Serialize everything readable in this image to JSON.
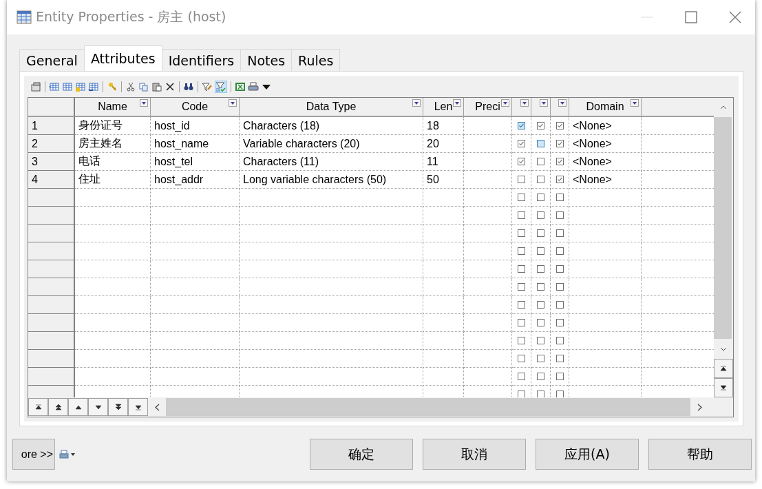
{
  "window": {
    "title": "Entity Properties - 房主 (host)"
  },
  "tabs": [
    {
      "label": "General",
      "selected": false
    },
    {
      "label": "Attributes",
      "selected": true
    },
    {
      "label": "Identifiers",
      "selected": false
    },
    {
      "label": "Notes",
      "selected": false
    },
    {
      "label": "Rules",
      "selected": false
    }
  ],
  "toolbar": {
    "filter_toggle_on": true
  },
  "table": {
    "columns": [
      {
        "kind": "text",
        "label": "Name"
      },
      {
        "kind": "text",
        "label": "Code"
      },
      {
        "kind": "text",
        "label": "Data Type"
      },
      {
        "kind": "text",
        "label": "Len"
      },
      {
        "kind": "text",
        "label": "Preci"
      },
      {
        "kind": "check"
      },
      {
        "kind": "check"
      },
      {
        "kind": "check"
      },
      {
        "kind": "text",
        "label": "Domain"
      }
    ],
    "rows": [
      {
        "number": "1",
        "name": "身份证号",
        "code": "host_id",
        "data_type": "Characters (18)",
        "length": "18",
        "domain": "<None>",
        "checks": [
          {
            "checked": true,
            "highlighted": true
          },
          {
            "checked": true,
            "highlighted": false
          },
          {
            "checked": true,
            "highlighted": false
          }
        ]
      },
      {
        "number": "2",
        "name": "房主姓名",
        "code": "host_name",
        "data_type": "Variable characters (20)",
        "length": "20",
        "domain": "<None>",
        "checks": [
          {
            "checked": true,
            "highlighted": false
          },
          {
            "checked": false,
            "highlighted": true
          },
          {
            "checked": true,
            "highlighted": false
          }
        ]
      },
      {
        "number": "3",
        "name": "电话",
        "code": "host_tel",
        "data_type": "Characters (11)",
        "length": "11",
        "domain": "<None>",
        "checks": [
          {
            "checked": true,
            "highlighted": false
          },
          {
            "checked": false,
            "highlighted": false
          },
          {
            "checked": true,
            "highlighted": false
          }
        ]
      },
      {
        "number": "4",
        "name": "住址",
        "code": "host_addr",
        "data_type": "Long variable characters (50)",
        "length": "50",
        "domain": "<None>",
        "checks": [
          {
            "checked": false,
            "highlighted": false
          },
          {
            "checked": false,
            "highlighted": false
          },
          {
            "checked": true,
            "highlighted": false
          }
        ]
      },
      {
        "checks": [
          {
            "checked": false,
            "highlighted": false
          },
          {
            "checked": false,
            "highlighted": false
          },
          {
            "checked": false,
            "highlighted": false
          }
        ]
      },
      {
        "checks": [
          {
            "checked": false,
            "highlighted": false
          },
          {
            "checked": false,
            "highlighted": false
          },
          {
            "checked": false,
            "highlighted": false
          }
        ]
      },
      {
        "checks": [
          {
            "checked": false,
            "highlighted": false
          },
          {
            "checked": false,
            "highlighted": false
          },
          {
            "checked": false,
            "highlighted": false
          }
        ]
      },
      {
        "checks": [
          {
            "checked": false,
            "highlighted": false
          },
          {
            "checked": false,
            "highlighted": false
          },
          {
            "checked": false,
            "highlighted": false
          }
        ]
      },
      {
        "checks": [
          {
            "checked": false,
            "highlighted": false
          },
          {
            "checked": false,
            "highlighted": false
          },
          {
            "checked": false,
            "highlighted": false
          }
        ]
      },
      {
        "checks": [
          {
            "checked": false,
            "highlighted": false
          },
          {
            "checked": false,
            "highlighted": false
          },
          {
            "checked": false,
            "highlighted": false
          }
        ]
      },
      {
        "checks": [
          {
            "checked": false,
            "highlighted": false
          },
          {
            "checked": false,
            "highlighted": false
          },
          {
            "checked": false,
            "highlighted": false
          }
        ]
      },
      {
        "checks": [
          {
            "checked": false,
            "highlighted": false
          },
          {
            "checked": false,
            "highlighted": false
          },
          {
            "checked": false,
            "highlighted": false
          }
        ]
      },
      {
        "checks": [
          {
            "checked": false,
            "highlighted": false
          },
          {
            "checked": false,
            "highlighted": false
          },
          {
            "checked": false,
            "highlighted": false
          }
        ]
      },
      {
        "checks": [
          {
            "checked": false,
            "highlighted": false
          },
          {
            "checked": false,
            "highlighted": false
          },
          {
            "checked": false,
            "highlighted": false
          }
        ]
      },
      {
        "checks": [
          {
            "checked": false,
            "highlighted": false
          },
          {
            "checked": false,
            "highlighted": false
          },
          {
            "checked": false,
            "highlighted": false
          }
        ]
      },
      {
        "checks": [
          {
            "checked": false,
            "highlighted": false
          },
          {
            "checked": false,
            "highlighted": false
          },
          {
            "checked": false,
            "highlighted": false
          }
        ]
      }
    ]
  },
  "more_button": "ore >>",
  "buttons": [
    "确定",
    "取消",
    "应用(A)",
    "帮助"
  ]
}
